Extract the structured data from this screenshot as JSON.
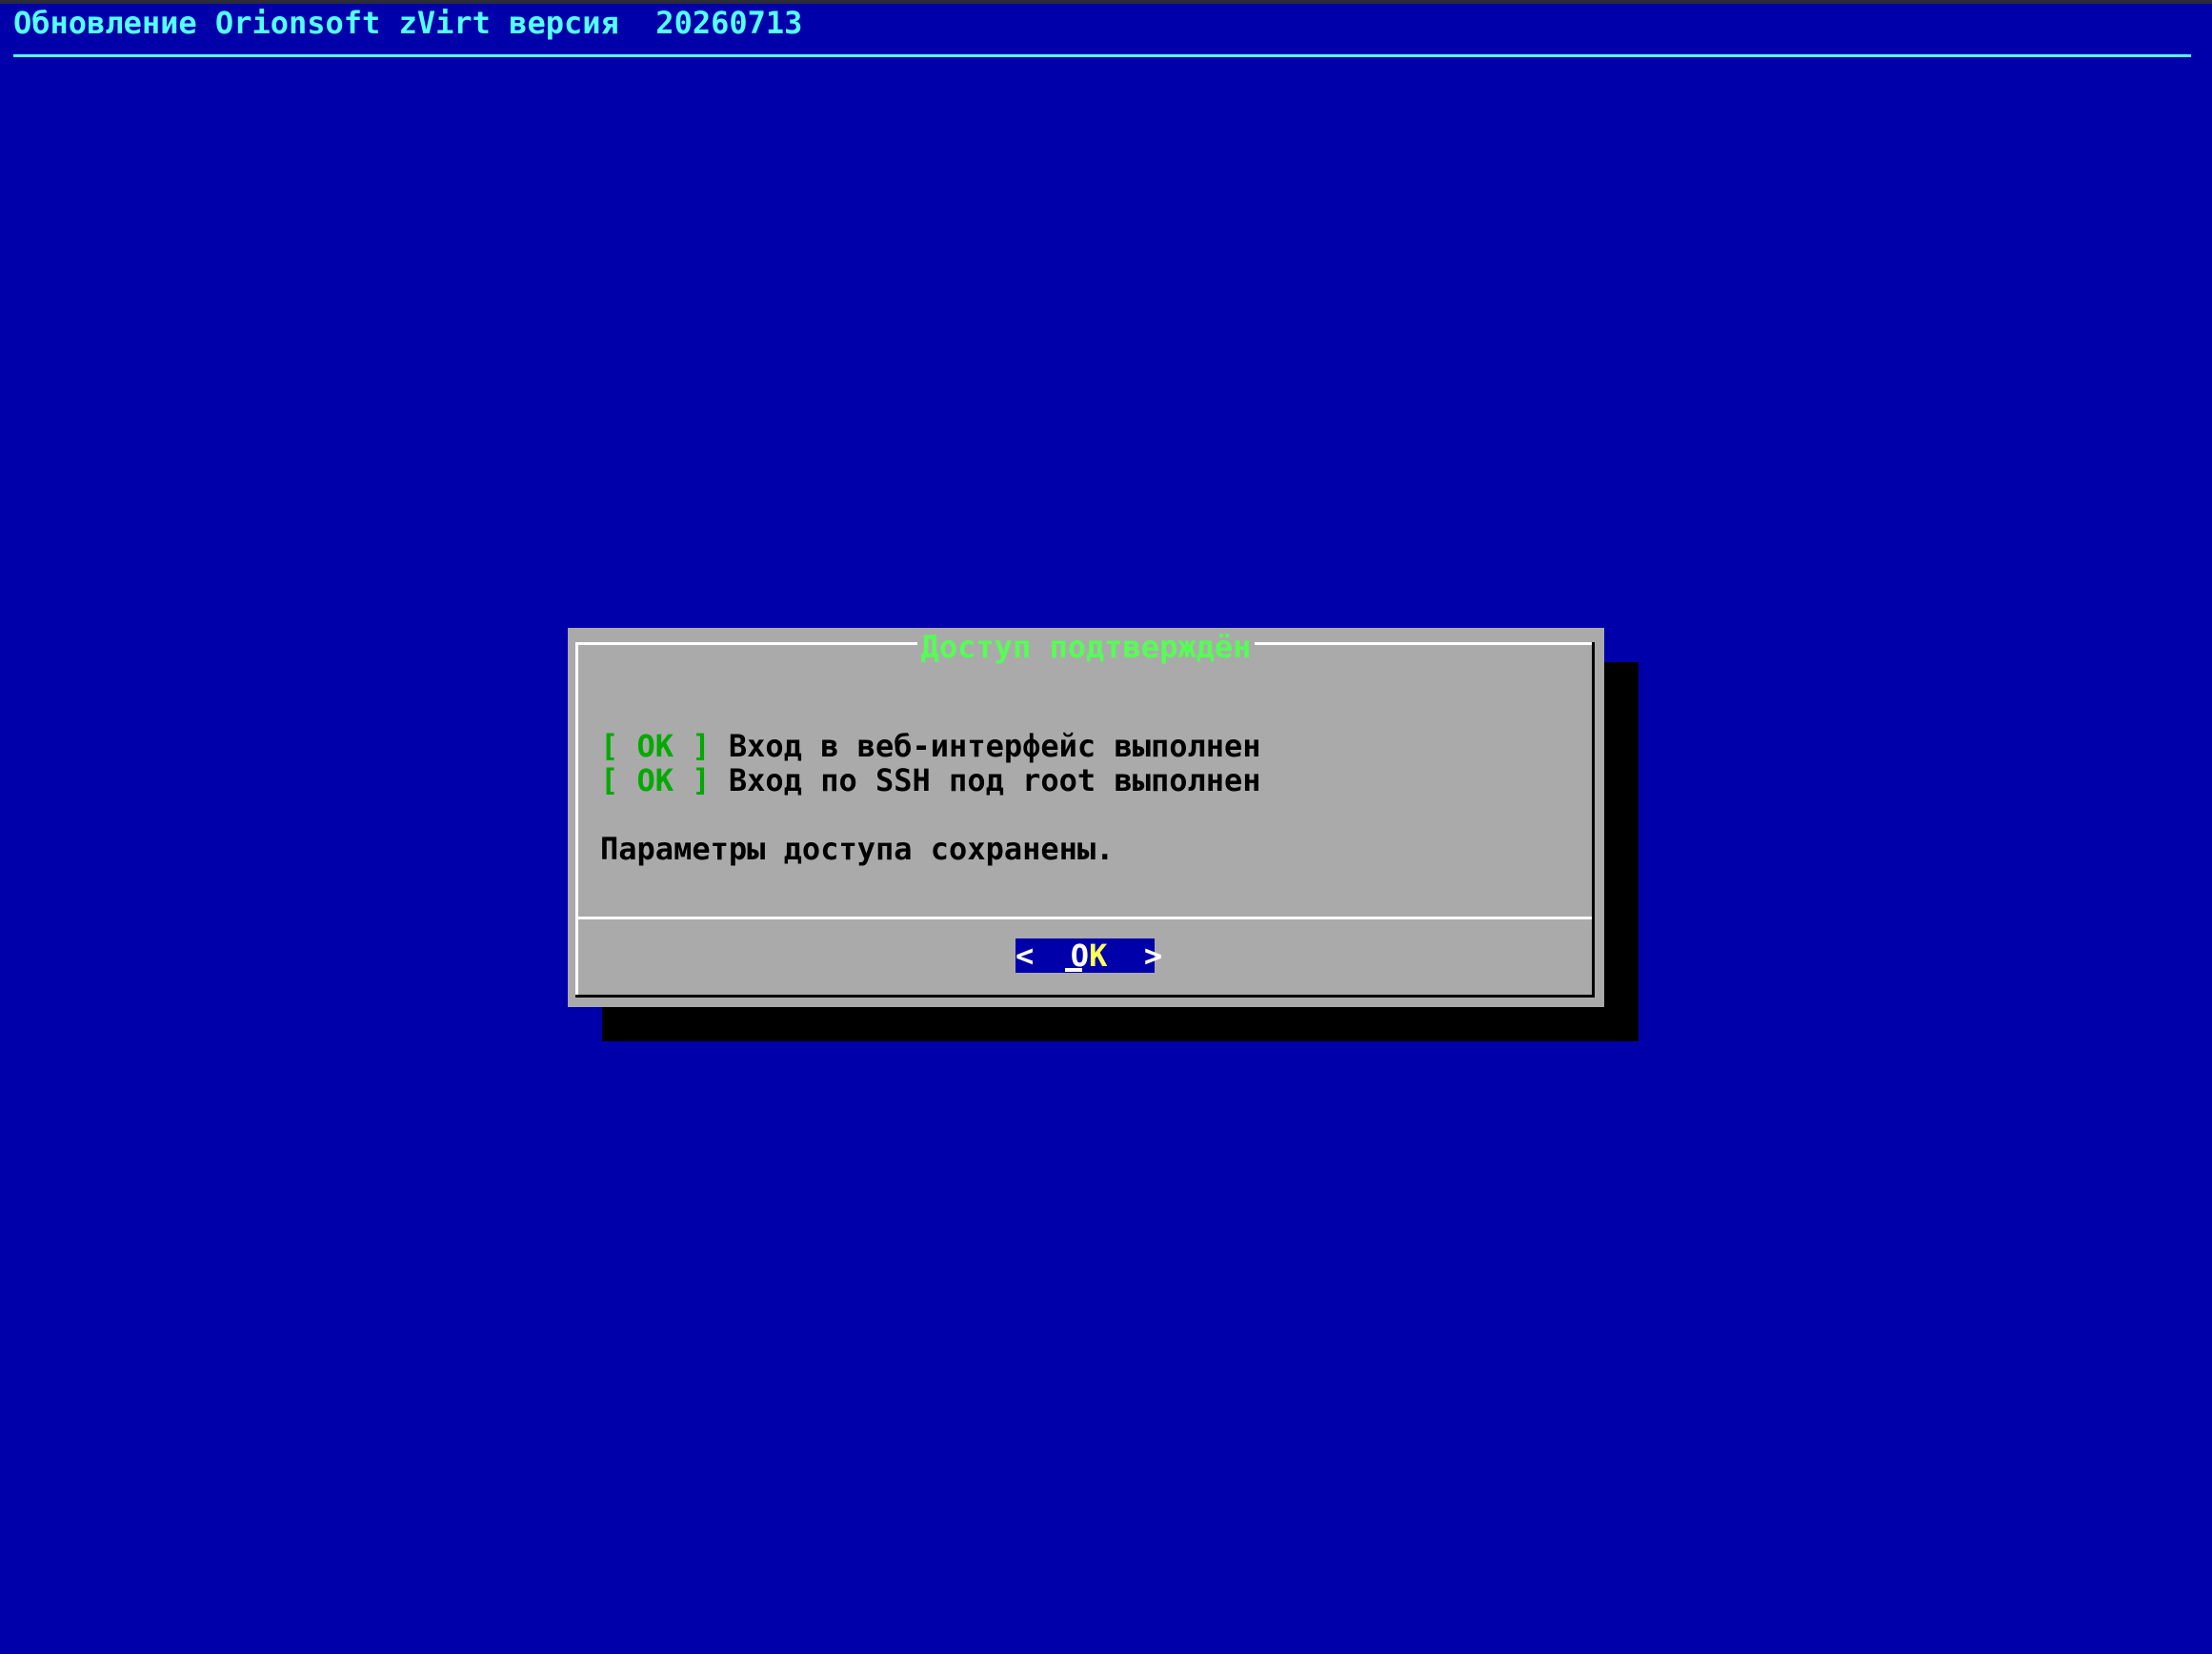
{
  "backtitle": "Обновление Orionsoft zVirt версия  20260713",
  "dialog": {
    "title": "Доступ подтверждён",
    "checks": [
      {
        "status": "[ OK ]",
        "text": "Вход в веб-интерфейс выполнен"
      },
      {
        "status": "[ OK ]",
        "text": "Вход по SSH под root выполнен"
      }
    ],
    "message": "Параметры доступа сохранены.",
    "button": {
      "left": "<",
      "label_first": "O",
      "label_hot": "K",
      "right": ">"
    }
  },
  "colors": {
    "background": "#0000aa",
    "backtitle": "#55ffff",
    "dialog": "#aaaaaa",
    "title": "#55ff55",
    "ok_tag": "#00aa00",
    "button_hot": "#ffff55"
  }
}
